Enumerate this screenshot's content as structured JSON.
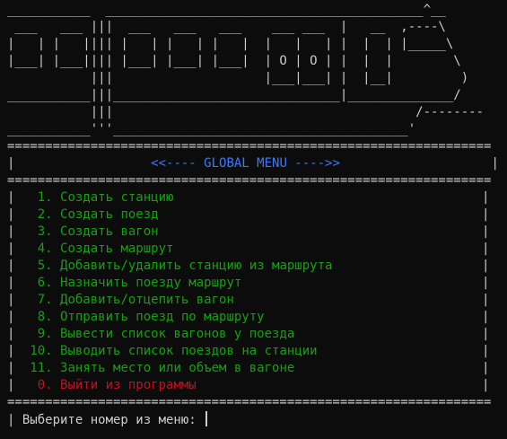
{
  "ascii_art": [
    "___________  __________________________________________^__",
    " ___   ___ |||  ___   ___   ___    ___ ___  |   __  ,----\\",
    "|   | |   |||| |   | |   | |   |  |   |   | |  |  | |_____\\",
    "|___| |___|||| |___| |___| |___|  | O | O | |  |  |        \\",
    "           |||                    |___|___| |  |__|         )",
    "___________|||______________________________|______________/",
    "           |||                                        /--------",
    "___________'''_______________________________________'"
  ],
  "separator_double": "================================================================",
  "separator_double_2": "================================================================",
  "menu_header": {
    "left": "|",
    "title": "<<---- GLOBAL MENU ---->>",
    "right": "|"
  },
  "menu_items": [
    {
      "num": "1.",
      "label": "Создать станцию"
    },
    {
      "num": "2.",
      "label": "Создать поезд"
    },
    {
      "num": "3.",
      "label": "Создать вагон"
    },
    {
      "num": "4.",
      "label": "Создать маршрут"
    },
    {
      "num": "5.",
      "label": "Добавить/удалить станцию из маршрута"
    },
    {
      "num": "6.",
      "label": "Назначить поезду маршрут"
    },
    {
      "num": "7.",
      "label": "Добавить/отцепить вагон"
    },
    {
      "num": "8.",
      "label": "Отправить поезд по маршруту"
    },
    {
      "num": "9.",
      "label": "Вывести список вагонов у поезда"
    },
    {
      "num": "10.",
      "label": "Выводить список поездов на станции"
    },
    {
      "num": "11.",
      "label": "Занять место или объем в вагоне"
    }
  ],
  "exit_item": {
    "num": "0.",
    "label": "Выйти из программы"
  },
  "prompt": "| Выберите номер из меню: ",
  "colors": {
    "background": "#0c0c0c",
    "text": "#cccccc",
    "header": "#3b78ff",
    "menu": "#13a10e",
    "exit": "#c50f1f"
  }
}
